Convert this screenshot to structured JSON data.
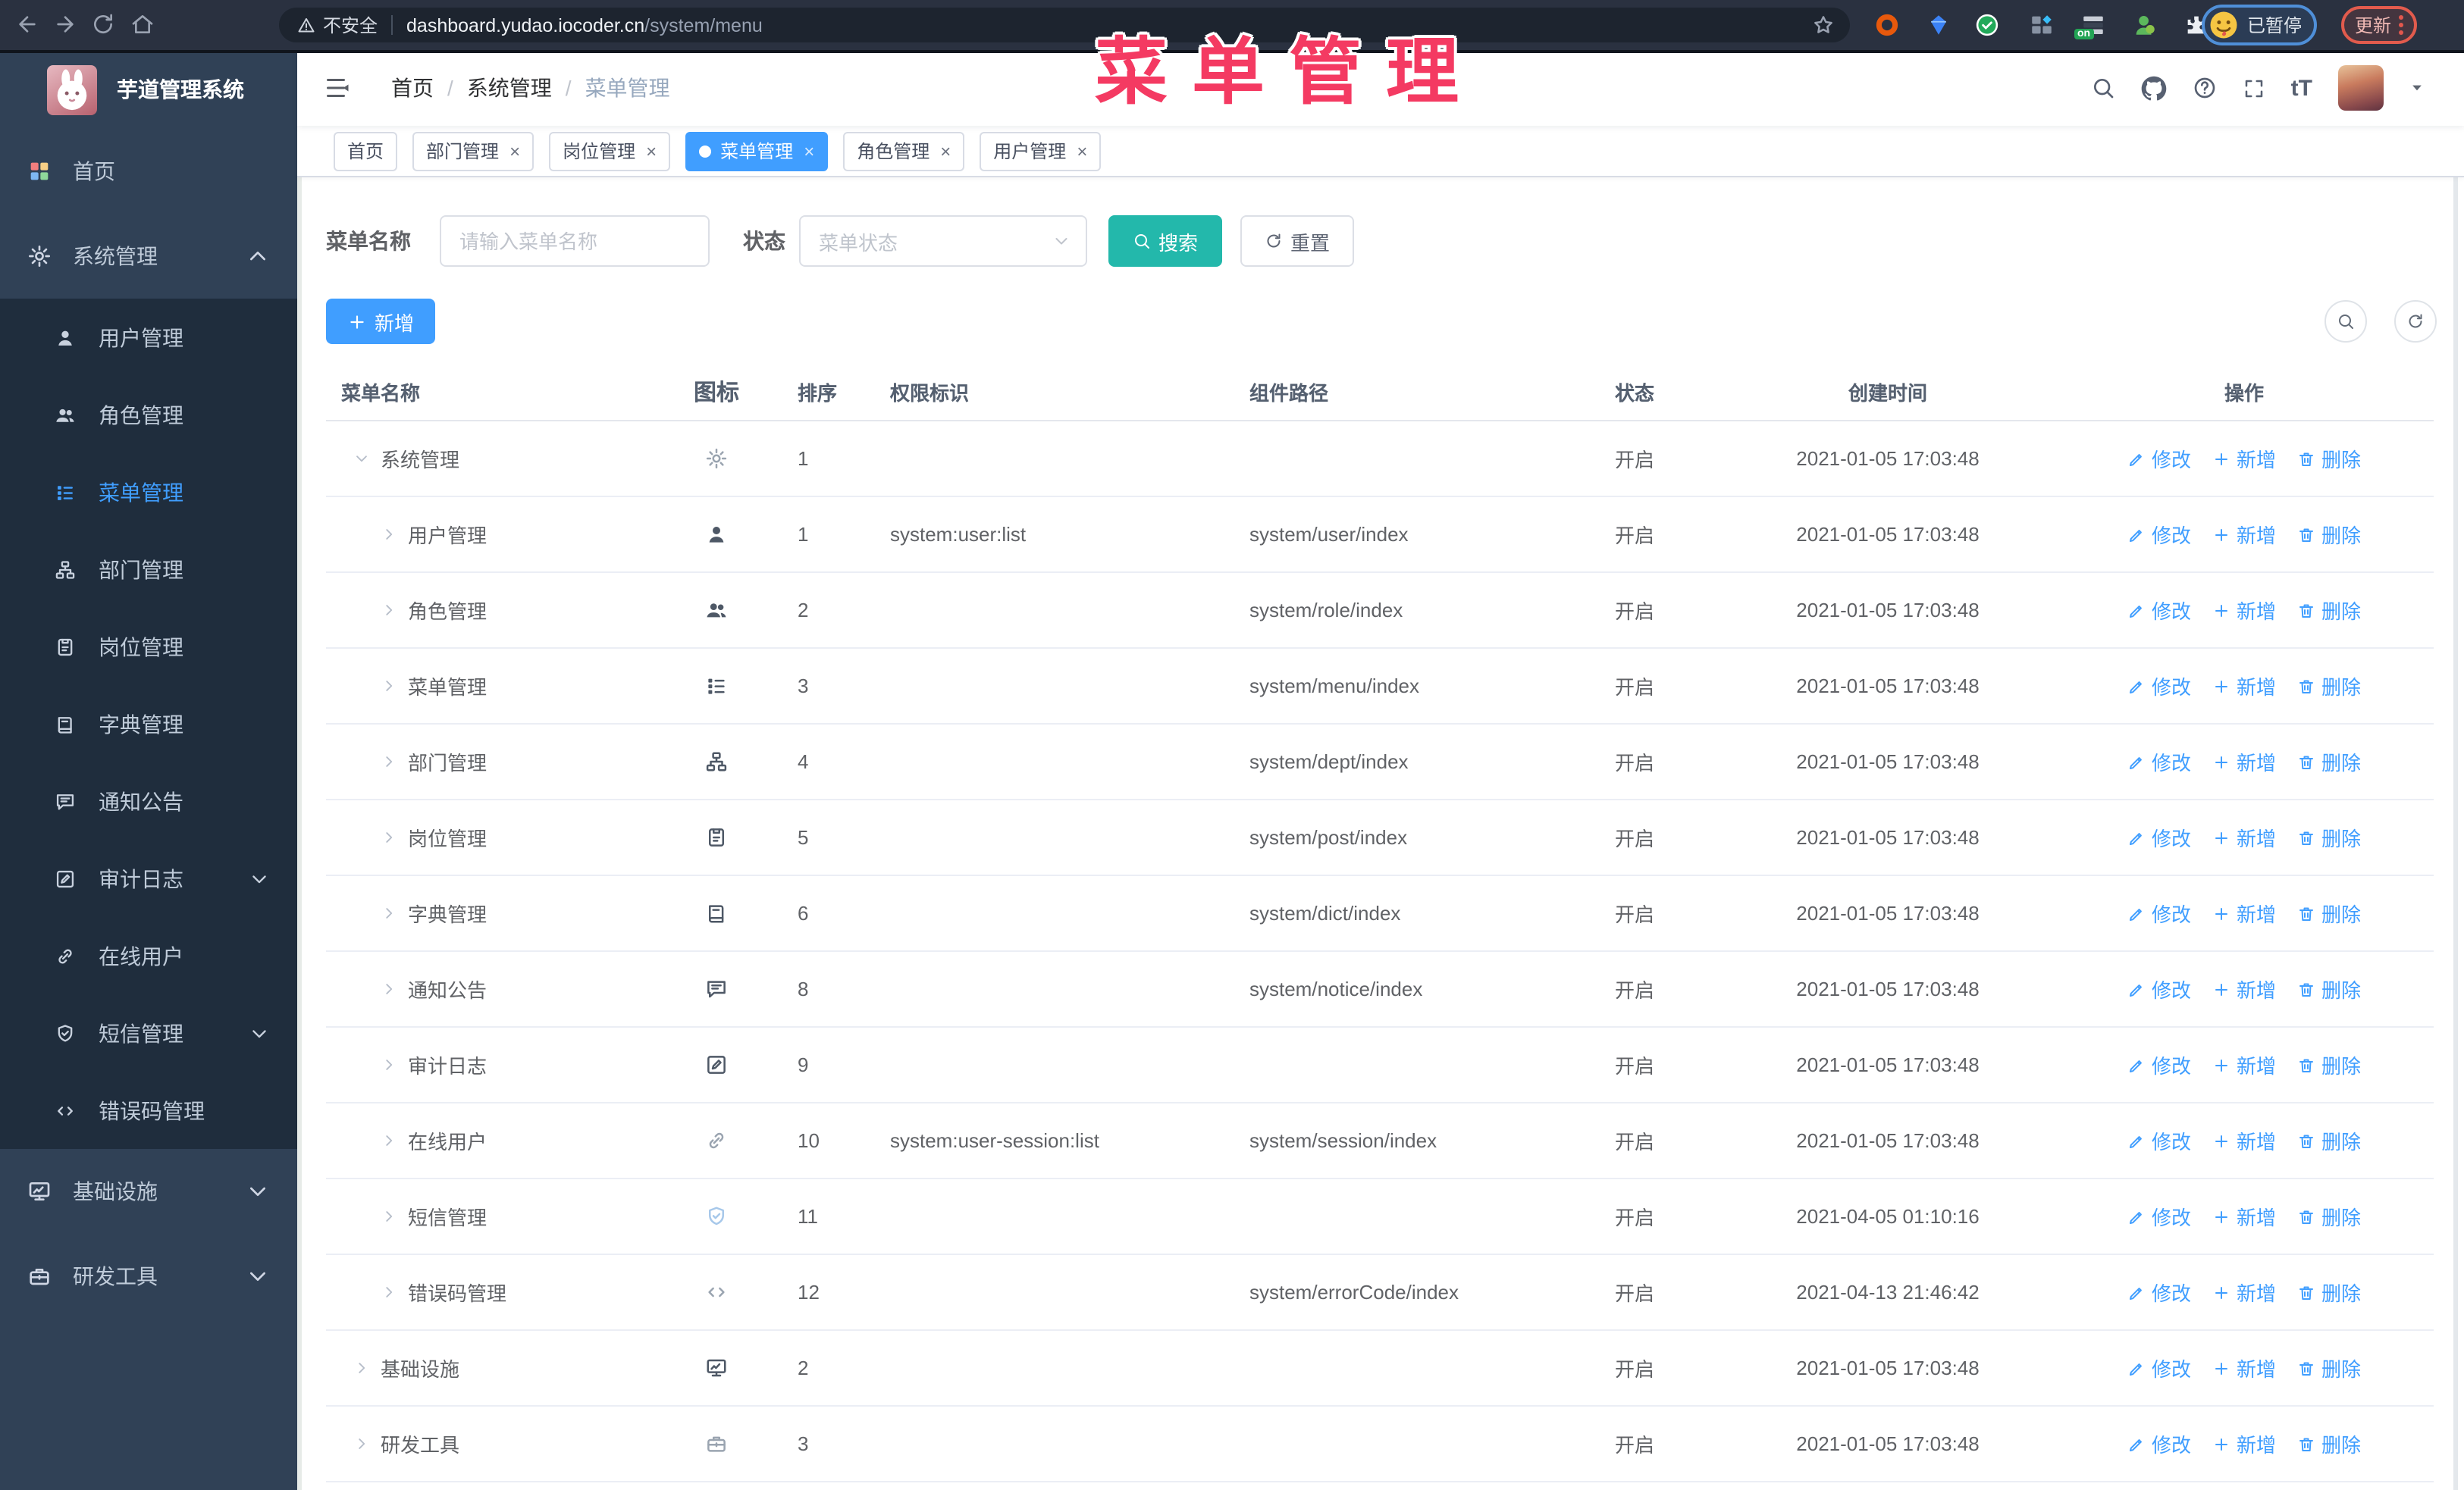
{
  "browser": {
    "security_label": "不安全",
    "url_host": "dashboard.yudao.iocoder.cn",
    "url_path": "/system/menu",
    "paused_badge_label": "已暂停",
    "update_button_label": "更新",
    "extension_on_badge": "on"
  },
  "overlay": {
    "title": "菜单管理",
    "color": "#f43a62"
  },
  "sidebar": {
    "app_title": "芋道管理系统",
    "menu": [
      {
        "slug": "home",
        "label": "首页",
        "icon": "dashboard-icon",
        "level": 0
      },
      {
        "slug": "system",
        "label": "系统管理",
        "icon": "gear-icon",
        "level": 0,
        "expanded": true
      },
      {
        "slug": "user",
        "label": "用户管理",
        "icon": "user-icon",
        "level": 1
      },
      {
        "slug": "role",
        "label": "角色管理",
        "icon": "users-icon",
        "level": 1
      },
      {
        "slug": "menu",
        "label": "菜单管理",
        "icon": "menu-list-icon",
        "level": 1,
        "active": true
      },
      {
        "slug": "dept",
        "label": "部门管理",
        "icon": "org-tree-icon",
        "level": 1
      },
      {
        "slug": "post",
        "label": "岗位管理",
        "icon": "badge-icon",
        "level": 1
      },
      {
        "slug": "dict",
        "label": "字典管理",
        "icon": "book-icon",
        "level": 1
      },
      {
        "slug": "notice",
        "label": "通知公告",
        "icon": "megaphone-icon",
        "level": 1
      },
      {
        "slug": "audit-log",
        "label": "审计日志",
        "icon": "audit-log-icon",
        "level": 1,
        "has_children": true
      },
      {
        "slug": "online-user",
        "label": "在线用户",
        "icon": "link-icon",
        "level": 1
      },
      {
        "slug": "sms",
        "label": "短信管理",
        "icon": "shield-icon",
        "level": 1,
        "has_children": true
      },
      {
        "slug": "error-code",
        "label": "错误码管理",
        "icon": "code-icon",
        "level": 1
      },
      {
        "slug": "infra",
        "label": "基础设施",
        "icon": "monitor-icon",
        "level": 0,
        "has_children": true
      },
      {
        "slug": "dev-tool",
        "label": "研发工具",
        "icon": "toolbox-icon",
        "level": 0,
        "has_children": true
      }
    ]
  },
  "navbar": {
    "breadcrumb": [
      "首页",
      "系统管理",
      "菜单管理"
    ]
  },
  "tags": [
    {
      "slug": "home",
      "label": "首页",
      "closable": false,
      "active": false
    },
    {
      "slug": "dept",
      "label": "部门管理",
      "closable": true,
      "active": false
    },
    {
      "slug": "post",
      "label": "岗位管理",
      "closable": true,
      "active": false
    },
    {
      "slug": "menu",
      "label": "菜单管理",
      "closable": true,
      "active": true
    },
    {
      "slug": "role",
      "label": "角色管理",
      "closable": true,
      "active": false
    },
    {
      "slug": "user",
      "label": "用户管理",
      "closable": true,
      "active": false
    }
  ],
  "filters": {
    "name_label": "菜单名称",
    "name_placeholder": "请输入菜单名称",
    "status_label": "状态",
    "status_placeholder": "菜单状态",
    "search_label": "搜索",
    "reset_label": "重置"
  },
  "toolbar": {
    "add_label": "新增"
  },
  "table": {
    "columns": [
      "菜单名称",
      "图标",
      "排序",
      "权限标识",
      "组件路径",
      "状态",
      "创建时间",
      "操作"
    ],
    "actions": [
      {
        "slug": "edit",
        "label": "修改",
        "icon": "edit-pencil-icon"
      },
      {
        "slug": "add",
        "label": "新增",
        "icon": "plus-icon"
      },
      {
        "slug": "delete",
        "label": "删除",
        "icon": "trash-icon"
      }
    ],
    "rows": [
      {
        "name": "系统管理",
        "level": 0,
        "expanded": true,
        "icon": "gear-icon",
        "icon_tone": "muted",
        "sort": "1",
        "perm": "",
        "path": "",
        "status": "开启",
        "created": "2021-01-05 17:03:48"
      },
      {
        "name": "用户管理",
        "level": 1,
        "icon": "user-icon",
        "icon_tone": "dark",
        "sort": "1",
        "perm": "system:user:list",
        "path": "system/user/index",
        "status": "开启",
        "created": "2021-01-05 17:03:48"
      },
      {
        "name": "角色管理",
        "level": 1,
        "icon": "users-icon",
        "icon_tone": "dark",
        "sort": "2",
        "perm": "",
        "path": "system/role/index",
        "status": "开启",
        "created": "2021-01-05 17:03:48"
      },
      {
        "name": "菜单管理",
        "level": 1,
        "icon": "menu-list-icon",
        "icon_tone": "dark",
        "sort": "3",
        "perm": "",
        "path": "system/menu/index",
        "status": "开启",
        "created": "2021-01-05 17:03:48"
      },
      {
        "name": "部门管理",
        "level": 1,
        "icon": "org-tree-icon",
        "icon_tone": "dark",
        "sort": "4",
        "perm": "",
        "path": "system/dept/index",
        "status": "开启",
        "created": "2021-01-05 17:03:48"
      },
      {
        "name": "岗位管理",
        "level": 1,
        "icon": "badge-icon",
        "icon_tone": "dark",
        "sort": "5",
        "perm": "",
        "path": "system/post/index",
        "status": "开启",
        "created": "2021-01-05 17:03:48"
      },
      {
        "name": "字典管理",
        "level": 1,
        "icon": "book-icon",
        "icon_tone": "dark",
        "sort": "6",
        "perm": "",
        "path": "system/dict/index",
        "status": "开启",
        "created": "2021-01-05 17:03:48"
      },
      {
        "name": "通知公告",
        "level": 1,
        "icon": "megaphone-icon",
        "icon_tone": "dark",
        "sort": "8",
        "perm": "",
        "path": "system/notice/index",
        "status": "开启",
        "created": "2021-01-05 17:03:48"
      },
      {
        "name": "审计日志",
        "level": 1,
        "icon": "audit-log-icon",
        "icon_tone": "dark",
        "sort": "9",
        "perm": "",
        "path": "",
        "status": "开启",
        "created": "2021-01-05 17:03:48"
      },
      {
        "name": "在线用户",
        "level": 1,
        "icon": "link-icon",
        "icon_tone": "muted",
        "sort": "10",
        "perm": "system:user-session:list",
        "path": "system/session/index",
        "status": "开启",
        "created": "2021-01-05 17:03:48"
      },
      {
        "name": "短信管理",
        "level": 1,
        "icon": "shield-icon",
        "icon_tone": "light-blue",
        "sort": "11",
        "perm": "",
        "path": "",
        "status": "开启",
        "created": "2021-04-05 01:10:16"
      },
      {
        "name": "错误码管理",
        "level": 1,
        "icon": "code-icon",
        "icon_tone": "muted",
        "sort": "12",
        "perm": "",
        "path": "system/errorCode/index",
        "status": "开启",
        "created": "2021-04-13 21:46:42"
      },
      {
        "name": "基础设施",
        "level": 0,
        "icon": "monitor-icon",
        "icon_tone": "dark",
        "sort": "2",
        "perm": "",
        "path": "",
        "status": "开启",
        "created": "2021-01-05 17:03:48"
      },
      {
        "name": "研发工具",
        "level": 0,
        "icon": "toolbox-icon",
        "icon_tone": "muted",
        "sort": "3",
        "perm": "",
        "path": "",
        "status": "开启",
        "created": "2021-01-05 17:03:48"
      }
    ]
  },
  "colors": {
    "primary": "#409eff",
    "search_button": "#23b8ab",
    "sidebar_bg": "#304156",
    "submenu_bg": "#1f2d3d",
    "overlay_title": "#f43a62"
  }
}
